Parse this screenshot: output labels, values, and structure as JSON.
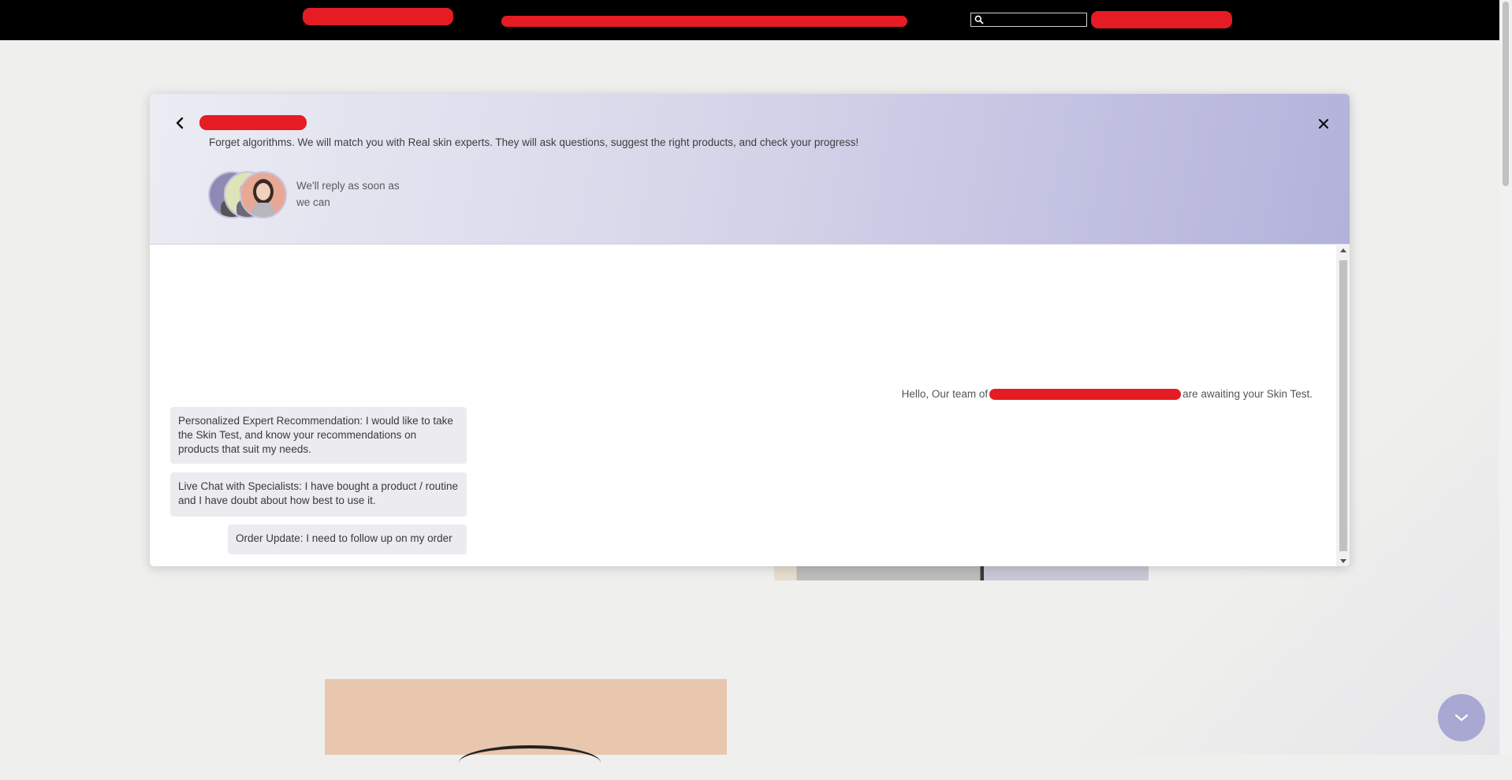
{
  "topbar": {
    "search": {
      "value": "",
      "placeholder": ""
    }
  },
  "chat": {
    "subtitle": "Forget algorithms. We will match you with Real skin experts. They will ask questions, suggest the right products, and check your progress!",
    "reply_note": "We'll reply as soon as we can",
    "greeting_prefix": "Hello, Our team of",
    "greeting_suffix": "are awaiting your Skin Test.",
    "options": [
      "Personalized Expert Recommendation: I would like to take the Skin Test, and know your recommendations on products that suit my needs.",
      "Live Chat with Specialists: I have bought a product / routine and I have doubt about how best to use it.",
      "Order Update: I need to follow up on my order"
    ]
  },
  "colors": {
    "redaction": "#e51c23",
    "header_gradient_end": "#b3b2db",
    "fab": "#a9a8d3"
  },
  "icons": {
    "back": "chevron-left-icon",
    "close": "close-icon",
    "search": "search-icon",
    "fab": "chevron-down-icon"
  }
}
